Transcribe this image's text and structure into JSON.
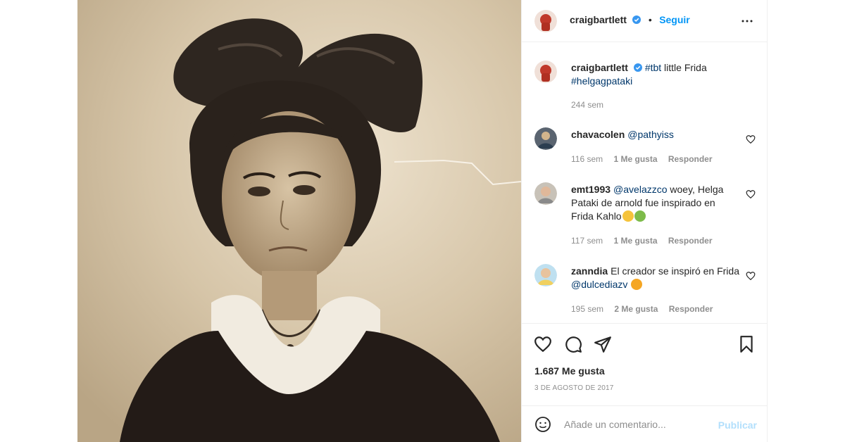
{
  "post": {
    "author": "craigbartlett",
    "follow_label": "Seguir",
    "separator": "•",
    "image_icon": "portrait-photo"
  },
  "caption": {
    "username": "craigbartlett",
    "text_prefix": "#tbt",
    "text_middle": " little Frida ",
    "text_suffix": "#helgagpataki",
    "time": "244 sem"
  },
  "comments": [
    {
      "username": "chavacolen",
      "text": "@pathyiss",
      "time": "116 sem",
      "likes": "1 Me gusta",
      "reply": "Responder"
    },
    {
      "username": "emt1993",
      "mention": "@avelazzco",
      "text": " woey, Helga Pataki de arnold fue inspirado en Frida Kahlo",
      "emoji_1": "smiling-face-with-hearts-emoji",
      "emoji_2": "nauseated-face-emoji",
      "time": "117 sem",
      "likes": "1 Me gusta",
      "reply": "Responder"
    },
    {
      "username": "zanndia",
      "text": "El creador se inspiró en Frida ",
      "mention": "@dulcediazv",
      "emoji_1": "cat-heart-eyes-emoji",
      "time": "195 sem",
      "likes": "2 Me gusta",
      "reply": "Responder"
    }
  ],
  "stats": {
    "likes": "1.687 Me gusta",
    "date": "3 DE AGOSTO DE 2017"
  },
  "composer": {
    "placeholder": "Añade un comentario...",
    "publish_label": "Publicar"
  },
  "colors": {
    "link_blue": "#0095f6",
    "hashtag_blue": "#00376b",
    "muted_gray": "#8e8e8e",
    "publish_disabled": "#b2dffc"
  }
}
